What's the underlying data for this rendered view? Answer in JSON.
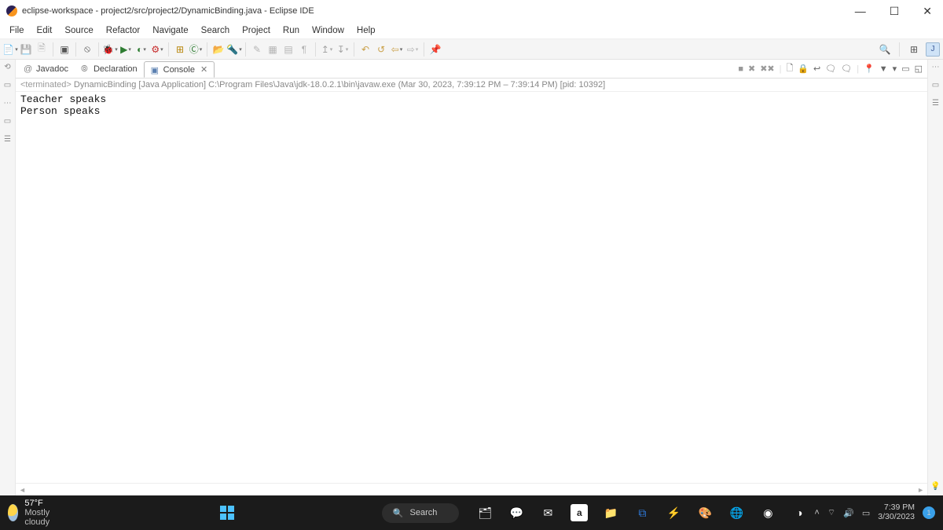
{
  "title": "eclipse-workspace - project2/src/project2/DynamicBinding.java - Eclipse IDE",
  "menu": [
    "File",
    "Edit",
    "Source",
    "Refactor",
    "Navigate",
    "Search",
    "Project",
    "Run",
    "Window",
    "Help"
  ],
  "tabs": {
    "javadoc": "Javadoc",
    "declaration": "Declaration",
    "console": "Console"
  },
  "terminated": {
    "prefix": "<terminated>",
    "body": "DynamicBinding [Java Application] C:\\Program Files\\Java\\jdk-18.0.2.1\\bin\\javaw.exe  (Mar 30, 2023, 7:39:12 PM – 7:39:14 PM) [pid: 10392]"
  },
  "console_output": "Teacher speaks\nPerson speaks",
  "taskbar": {
    "temp": "57°F",
    "cond": "Mostly cloudy",
    "search": "Search",
    "time": "7:39 PM",
    "date": "3/30/2023"
  }
}
